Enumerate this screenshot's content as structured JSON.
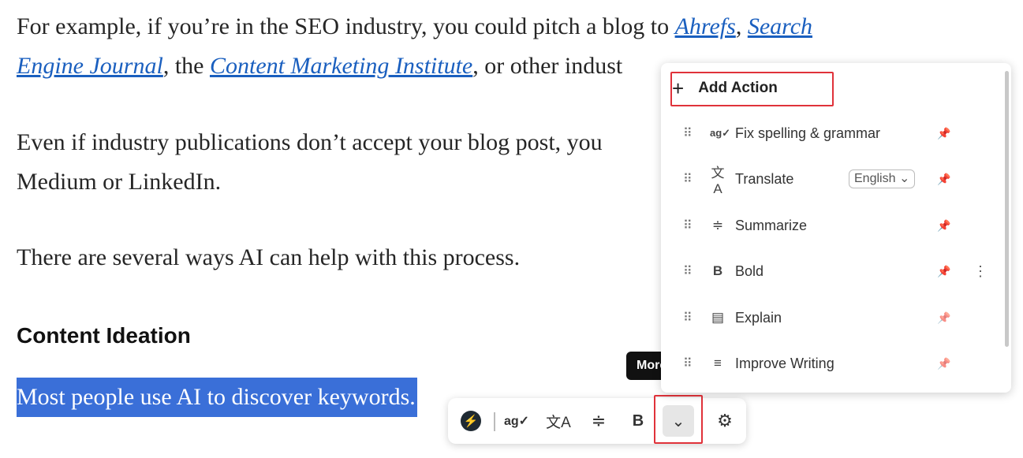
{
  "article": {
    "p1": {
      "t1": "For example, if you’re in the SEO industry, you could pitch a blog to ",
      "link1": "Ahrefs",
      "t2": ", ",
      "link2": "Search",
      "link2b": "Engine Journal",
      "t3": ", the ",
      "link3": "Content Marketing Institute",
      "t4": ", or other indust"
    },
    "p2a": "Even if industry publications don’t accept your blog post, you",
    "p2b": "Medium or LinkedIn.",
    "p3": "There are several ways AI can help with this process.",
    "heading": "Content Ideation",
    "selected": "Most people use AI to discover keywords."
  },
  "tooltip": "More",
  "toolbar": {
    "logo_icon": "lightning-icon",
    "bold": "B"
  },
  "menu": {
    "add_action": "Add Action",
    "items": [
      {
        "label": "Fix spelling & grammar",
        "icon": "spellcheck-icon",
        "pinned": true
      },
      {
        "label": "Translate",
        "icon": "translate-icon",
        "language": "English",
        "pinned": true
      },
      {
        "label": "Summarize",
        "icon": "summarize-icon",
        "pinned": true
      },
      {
        "label": "Bold",
        "icon": "bold-icon",
        "pinned": true
      },
      {
        "label": "Explain",
        "icon": "book-icon",
        "pinned": false
      },
      {
        "label": "Improve Writing",
        "icon": "improve-icon",
        "pinned": false
      }
    ]
  },
  "colors": {
    "link": "#1a5fbf",
    "selection": "#3a6fd8",
    "highlight_box": "#e0323a"
  }
}
